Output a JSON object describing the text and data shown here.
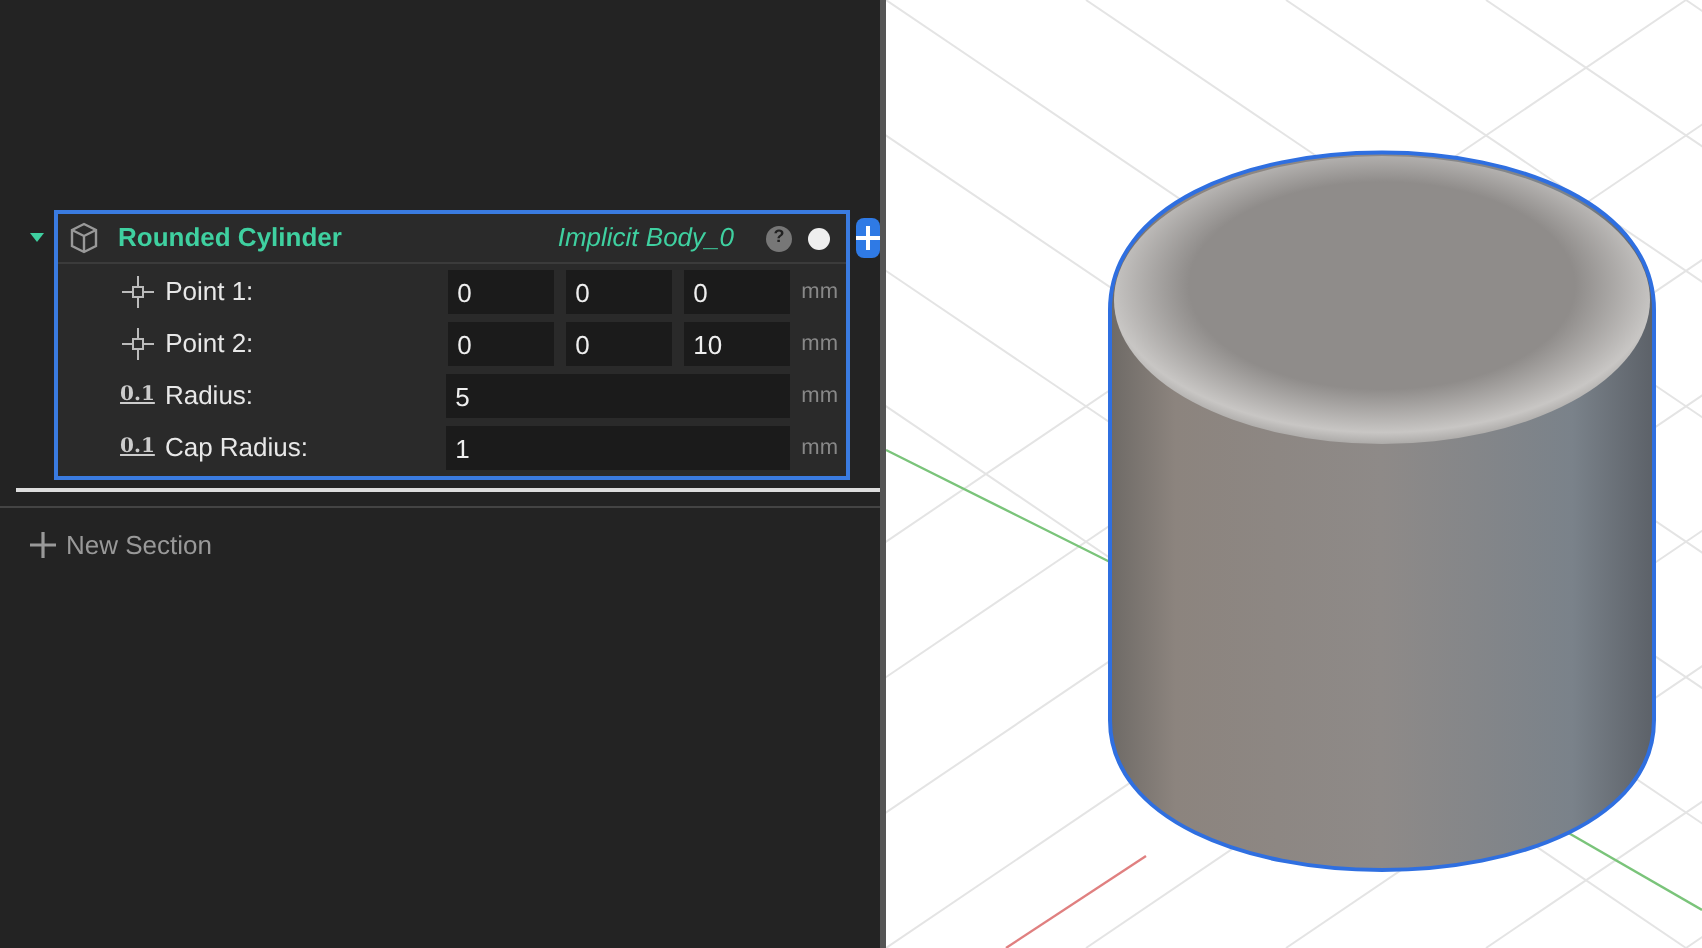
{
  "node": {
    "expanded": true,
    "title": "Rounded Cylinder",
    "body": "Implicit Body_0",
    "help": "?",
    "rows": [
      {
        "kind": "point",
        "label": "Point 1:",
        "values": [
          "0",
          "0",
          "0"
        ],
        "unit": "mm"
      },
      {
        "kind": "point",
        "label": "Point 2:",
        "values": [
          "0",
          "0",
          "10"
        ],
        "unit": "mm"
      },
      {
        "kind": "number",
        "icon_text": "0.1",
        "label": "Radius:",
        "values": [
          "5"
        ],
        "unit": "mm"
      },
      {
        "kind": "number",
        "icon_text": "0.1",
        "label": "Cap Radius:",
        "values": [
          "1"
        ],
        "unit": "mm"
      }
    ]
  },
  "new_section": "New Section"
}
